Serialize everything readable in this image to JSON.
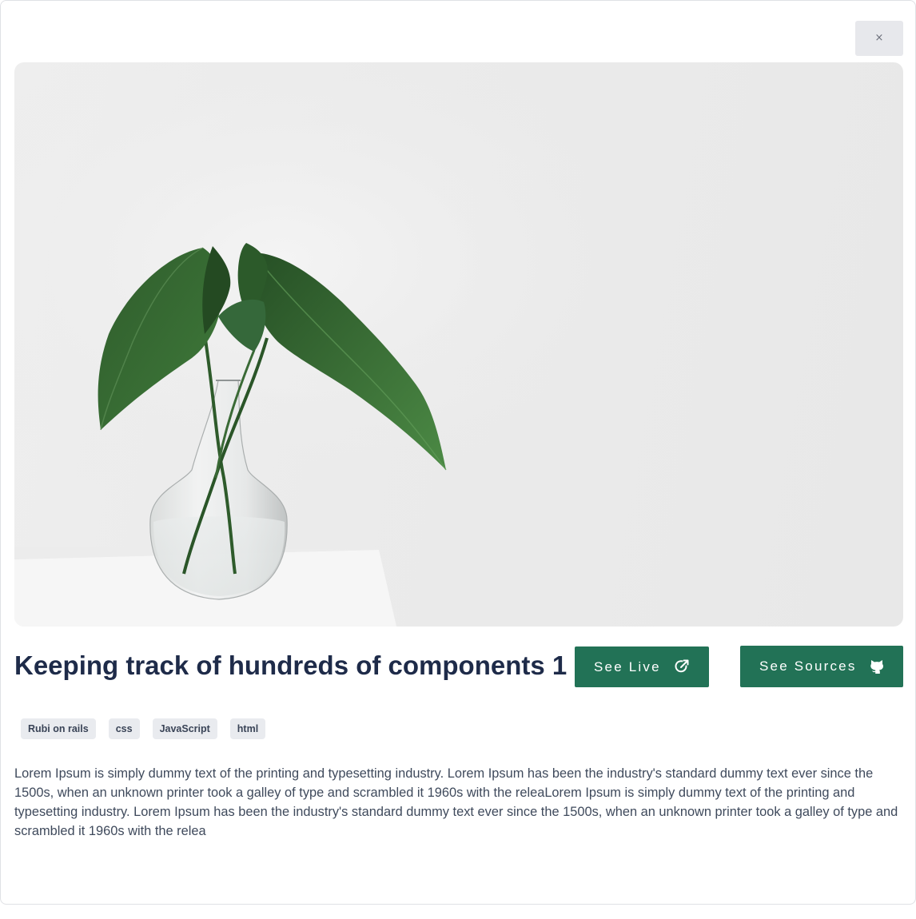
{
  "modal": {
    "close_label": "×",
    "title": "Keeping track of hundreds of components 1",
    "see_live_label": "See Live",
    "see_sources_label": "See Sources",
    "tags": [
      "Rubi on rails",
      "css",
      "JavaScript",
      "html"
    ],
    "description": "Lorem Ipsum is simply dummy text of the printing and typesetting industry. Lorem Ipsum has been the industry's standard dummy text ever since the 1500s, when an unknown printer took a galley of type and scrambled it 1960s with the releaLorem Ipsum is simply dummy text of the printing and typesetting industry. Lorem Ipsum has been the industry's standard dummy text ever since the 1500s, when an unknown printer took a galley of type and scrambled it 1960s with the relea",
    "icons": {
      "close": "close-icon",
      "see_live": "external-link-icon",
      "see_sources": "github-icon",
      "hero": "plant-in-vase-image"
    }
  },
  "colors": {
    "accent": "#227256",
    "title": "#1e2b49",
    "tag_bg": "#e9ebef",
    "close_bg": "#e7e8ec"
  }
}
